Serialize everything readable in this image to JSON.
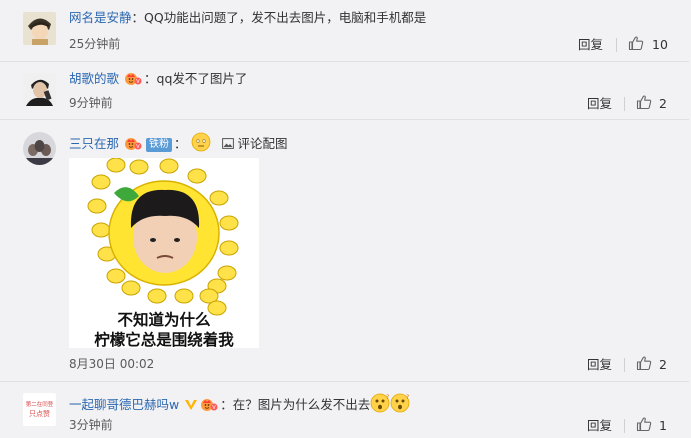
{
  "comments": [
    {
      "username": "网名是安静",
      "separator": "：",
      "text": "QQ功能出问题了，发不出去图片，电脑和手机都是",
      "time": "25分钟前",
      "reply_label": "回复",
      "likes": "10"
    },
    {
      "username": "胡歌的歌",
      "separator": "：",
      "text": "qq发不了图片了",
      "time": "9分钟前",
      "reply_label": "回复",
      "likes": "2"
    },
    {
      "username": "三只在那",
      "fan_badge": "铁粉",
      "separator": "：",
      "comment_pic_label": "评论配图",
      "meme_caption_line1": "不知道为什么",
      "meme_caption_line2": "柠檬它总是围绕着我",
      "time": "8月30日 00:02",
      "reply_label": "回复",
      "likes": "2"
    },
    {
      "username": "一起聊哥德巴赫吗w",
      "separator": "：",
      "text": "在？图片为什么发不出去",
      "time": "3分钟前",
      "reply_label": "回复",
      "likes": "1",
      "avatar_text_line1": "第二在同登",
      "avatar_text_line2": "只点赞"
    }
  ],
  "colors": {
    "username": "#2b67b0",
    "background": "#f2f2f5",
    "badge": "#5b9bd5"
  }
}
